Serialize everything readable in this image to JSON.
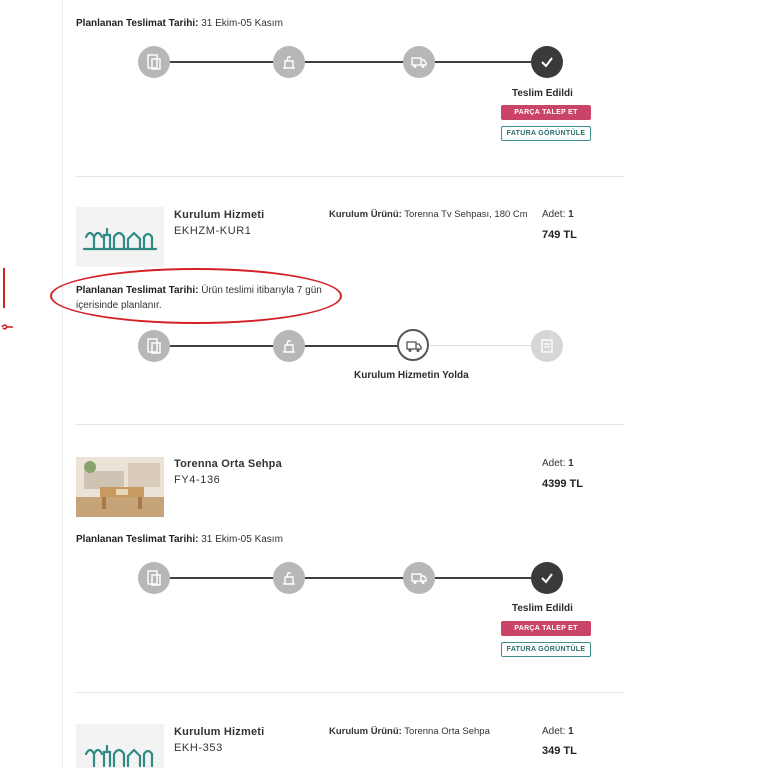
{
  "plan_label": "Planlanan Teslimat Tarihi:",
  "orders": [
    {
      "plan_value": "31 Ekim-05 Kasım",
      "status_label": "Teslim Edildi",
      "btn_request": "PARÇA TALEP ET",
      "btn_invoice": "FATURA GÖRÜNTÜLE"
    },
    {
      "name": "Kurulum Hizmeti",
      "code": "EKHZM-KUR1",
      "kurulum_label": "Kurulum Ürünü:",
      "kurulum_value": "Torenna Tv Sehpası, 180 Cm",
      "qty_label": "Adet:",
      "qty_value": "1",
      "price": "749 TL",
      "plan_value": "Ürün teslimi itibarıyla 7 gün",
      "plan_value_line2": "içerisinde planlanır.",
      "status_label": "Kurulum Hizmetin Yolda"
    },
    {
      "name": "Torenna Orta Sehpa",
      "code": "FY4-136",
      "qty_label": "Adet:",
      "qty_value": "1",
      "price": "4399 TL",
      "plan_value": "31 Ekim-05 Kasım",
      "status_label": "Teslim Edildi",
      "btn_request": "PARÇA TALEP ET",
      "btn_invoice": "FATURA GÖRÜNTÜLE"
    },
    {
      "name": "Kurulum Hizmeti",
      "code": "EKH-353",
      "kurulum_label": "Kurulum Ürünü:",
      "kurulum_value": "Torenna Orta Sehpa",
      "qty_label": "Adet:",
      "qty_value": "1",
      "price": "349 TL"
    }
  ],
  "icons": {
    "step1": "order-box-icon",
    "step2": "assembly-icon",
    "step3": "delivery-truck-icon",
    "step4": "check-icon"
  },
  "colors": {
    "accent_red": "#c94466",
    "accent_teal": "#3b8e8e",
    "step_grey": "#b7b7b7",
    "step_done": "#3a3a3a",
    "annotation_red": "#d41f26"
  }
}
